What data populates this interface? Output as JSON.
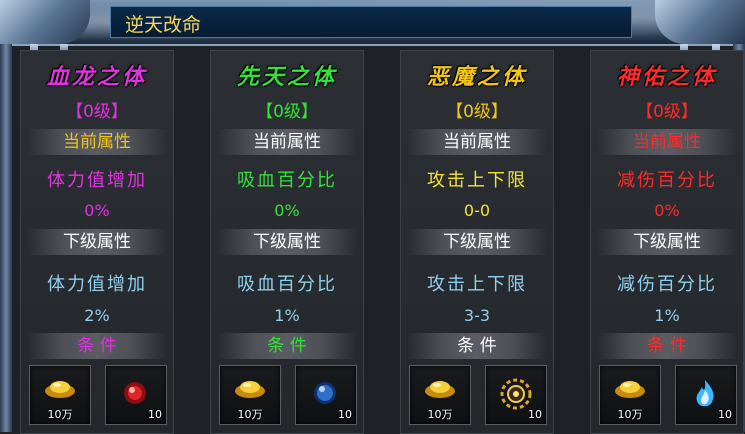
{
  "window": {
    "title": "逆天改命"
  },
  "colors": {
    "bloodDragon": "#e033e0",
    "innate": "#36e03a",
    "demon": "#f2c418",
    "divine": "#ff2a2a",
    "attr": "#8fd0ee",
    "header": "#ffffff"
  },
  "columns": [
    {
      "name": "血龙之体",
      "level": "【0级】",
      "current_header": "当前属性",
      "current_attr": "体力值增加",
      "current_value": "0%",
      "next_header": "下级属性",
      "next_attr": "体力值增加",
      "next_value": "2%",
      "condition_header": "条 件",
      "items": [
        {
          "icon": "gold-ingot-icon",
          "count": "10万"
        },
        {
          "icon": "red-gem-icon",
          "count": "10"
        }
      ]
    },
    {
      "name": "先天之体",
      "level": "【0级】",
      "current_header": "当前属性",
      "current_attr": "吸血百分比",
      "current_value": "0%",
      "next_header": "下级属性",
      "next_attr": "吸血百分比",
      "next_value": "1%",
      "condition_header": "条 件",
      "items": [
        {
          "icon": "gold-ingot-icon",
          "count": "10万"
        },
        {
          "icon": "blue-orb-icon",
          "count": "10"
        }
      ]
    },
    {
      "name": "恶魔之体",
      "level": "【0级】",
      "current_header": "当前属性",
      "current_attr": "攻击上下限",
      "current_value": "0-0",
      "next_header": "下级属性",
      "next_attr": "攻击上下限",
      "next_value": "3-3",
      "condition_header": "条 件",
      "items": [
        {
          "icon": "gold-ingot-icon",
          "count": "10万"
        },
        {
          "icon": "sun-medallion-icon",
          "count": "10"
        }
      ]
    },
    {
      "name": "神佑之体",
      "level": "【0级】",
      "current_header": "当前属性",
      "current_attr": "减伤百分比",
      "current_value": "0%",
      "next_header": "下级属性",
      "next_attr": "减伤百分比",
      "next_value": "1%",
      "condition_header": "条 件",
      "items": [
        {
          "icon": "gold-ingot-icon",
          "count": "10万"
        },
        {
          "icon": "blue-flame-icon",
          "count": "10"
        }
      ]
    }
  ]
}
